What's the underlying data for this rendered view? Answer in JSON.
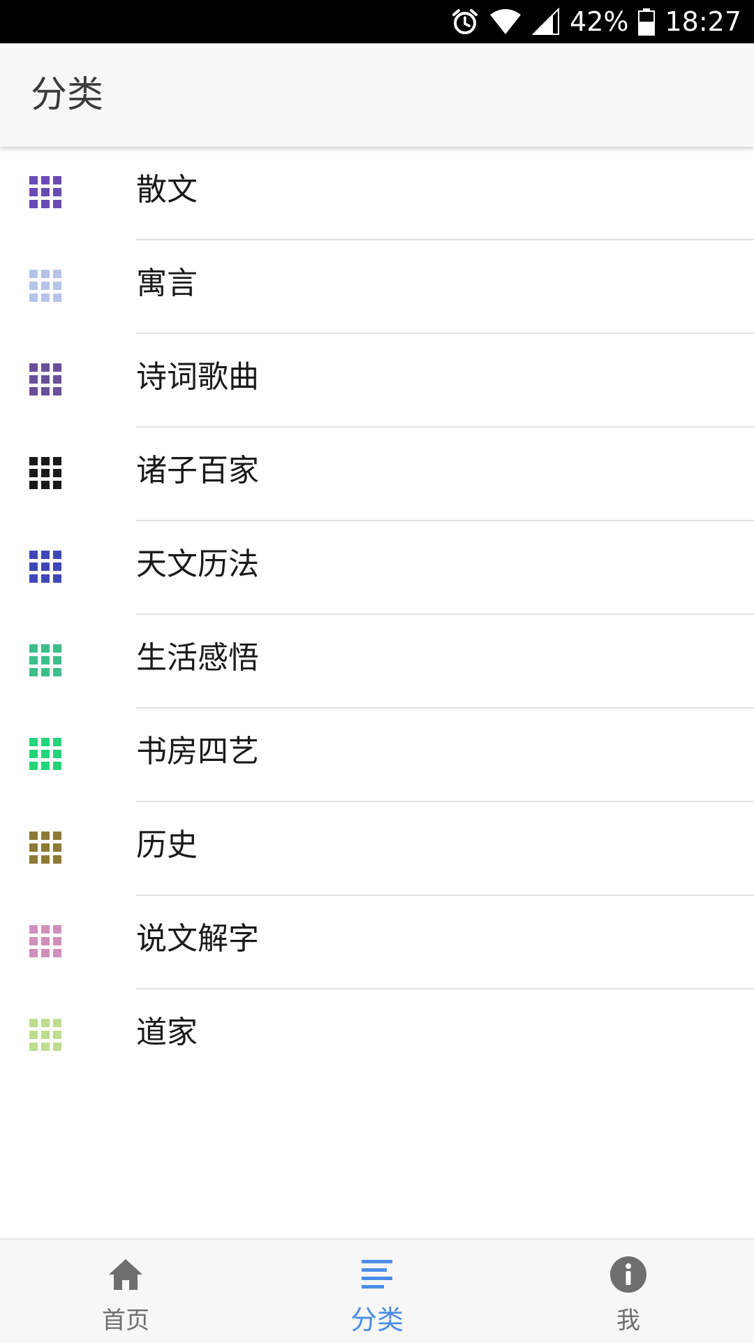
{
  "status_bar": {
    "battery": "42%",
    "time": "18:27"
  },
  "app_bar": {
    "title": "分类"
  },
  "categories": [
    {
      "label": "散文",
      "color": "#6a4bb5"
    },
    {
      "label": "寓言",
      "color": "#b6c3e8"
    },
    {
      "label": "诗词歌曲",
      "color": "#6a4f9a"
    },
    {
      "label": "诸子百家",
      "color": "#1a1a1a"
    },
    {
      "label": "天文历法",
      "color": "#3f47b8"
    },
    {
      "label": "生活感悟",
      "color": "#3dbf8a"
    },
    {
      "label": "书房四艺",
      "color": "#22d47a"
    },
    {
      "label": "历史",
      "color": "#8c7a35"
    },
    {
      "label": "说文解字",
      "color": "#d08fba"
    },
    {
      "label": "道家",
      "color": "#bedd8e"
    }
  ],
  "bottom_nav": {
    "items": [
      {
        "label": "首页",
        "icon": "home-icon",
        "active": false
      },
      {
        "label": "分类",
        "icon": "list-icon",
        "active": true
      },
      {
        "label": "我",
        "icon": "info-icon",
        "active": false
      }
    ],
    "active_color": "#4a8de8",
    "inactive_color": "#6e6e6e"
  }
}
